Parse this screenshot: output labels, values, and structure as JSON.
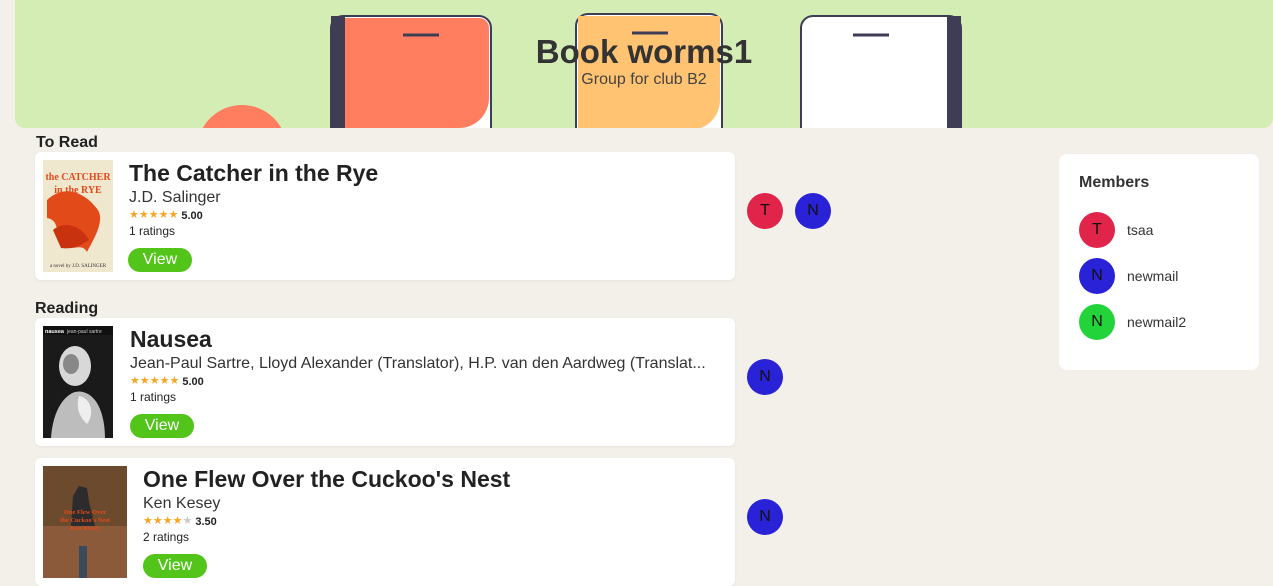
{
  "group": {
    "title": "Book worms1",
    "subtitle": "Group for club B2"
  },
  "colors": {
    "banner": "#d4edb5",
    "phone1": "#ff7e5f",
    "phone2": "#ffc371",
    "view_button": "#52c41a",
    "member_t": "#e0244a",
    "member_n": "#2a22d6",
    "member_n2": "#22d43a"
  },
  "sections": {
    "to_read": "To Read",
    "reading": "Reading"
  },
  "books": [
    {
      "title": "The Catcher in the Rye",
      "author": "J.D. Salinger",
      "stars": 5,
      "rating": "5.00",
      "ratings_count": "1 ratings",
      "view_label": "View",
      "readers": [
        "T",
        "N"
      ],
      "cover_text": "the CATCHER in the RYE"
    },
    {
      "title": "Nausea",
      "author": "Jean-Paul Sartre, Lloyd Alexander (Translator), H.P. van den Aardweg (Translat...",
      "stars": 5,
      "rating": "5.00",
      "ratings_count": "1 ratings",
      "view_label": "View",
      "readers": [
        "N"
      ],
      "cover_text": "nausea jean-paul sartre"
    },
    {
      "title": "One Flew Over the Cuckoo's Nest",
      "author": "Ken Kesey",
      "stars": 4,
      "rating": "3.50",
      "ratings_count": "2 ratings",
      "view_label": "View",
      "readers": [
        "N"
      ],
      "cover_text": "One Flew Over the Cuckoo's Nest Ken Kesey"
    }
  ],
  "members": {
    "title": "Members",
    "list": [
      {
        "initial": "T",
        "name": "tsaa"
      },
      {
        "initial": "N",
        "name": "newmail"
      },
      {
        "initial": "N",
        "name": "newmail2"
      }
    ]
  }
}
